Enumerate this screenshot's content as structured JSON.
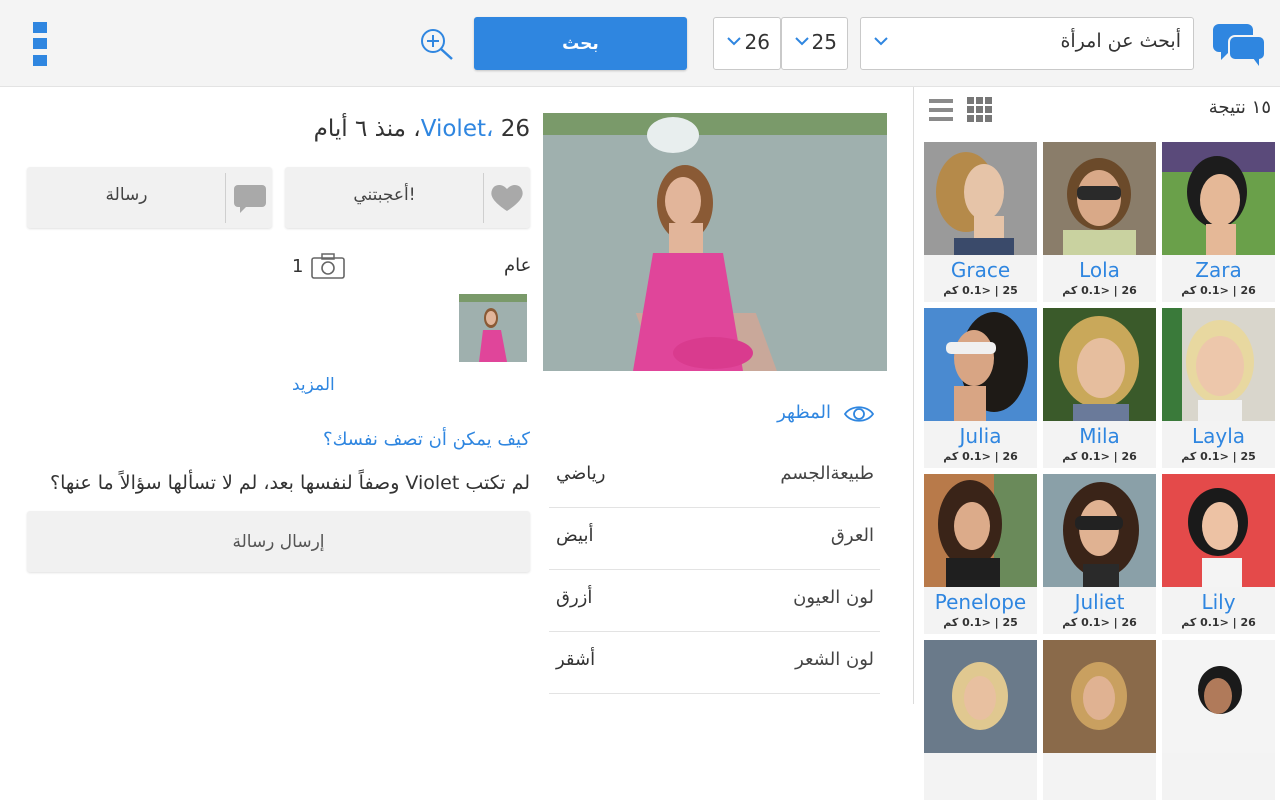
{
  "header": {
    "search_button_label": "بحث",
    "age_from": "25",
    "age_to": "26",
    "seeking": "أبحث عن امرأة",
    "icons": [
      "menu-icon",
      "zoom-in-icon",
      "chevron-down-icon",
      "chat-icon"
    ],
    "accent_color": "#2f86e0"
  },
  "results": {
    "count_label": "١٥ نتيجة",
    "view_icons": [
      "list-view-icon",
      "grid-view-icon"
    ],
    "cards": [
      {
        "name": "Zara",
        "info": "26 | <0.1 كم"
      },
      {
        "name": "Lola",
        "info": "26 | <0.1 كم"
      },
      {
        "name": "Grace",
        "info": "25 | <0.1 كم"
      },
      {
        "name": "Layla",
        "info": "25 | <0.1 كم"
      },
      {
        "name": "Mila",
        "info": "26 | <0.1 كم"
      },
      {
        "name": "Julia",
        "info": "26 | <0.1 كم"
      },
      {
        "name": "Lily",
        "info": "26 | <0.1 كم"
      },
      {
        "name": "Juliet",
        "info": "26 | <0.1 كم"
      },
      {
        "name": "Penelope",
        "info": "25 | <0.1 كم"
      }
    ]
  },
  "profile": {
    "name": "Violet",
    "sep": "، ",
    "meta": "26، منذ ٦ أيام",
    "like_label": "أعجبتني!",
    "message_label": "رسالة",
    "public_label": "عام",
    "photo_count": "1",
    "more_label": "المزيد",
    "question": "كيف يمكن أن تصف نفسك؟",
    "question_text": "لم تكتب Violet وصفاً لنفسها بعد، لم لا تسألها سؤالاً ما عنها؟",
    "send_message_label": "إرسال رسالة",
    "appearance_label": "المظهر",
    "attributes": [
      {
        "key": "طبيعةالجسم",
        "value": "رياضي"
      },
      {
        "key": "العرق",
        "value": "أبيض"
      },
      {
        "key": "لون العيون",
        "value": "أزرق"
      },
      {
        "key": "لون الشعر",
        "value": "أشقر"
      }
    ]
  }
}
